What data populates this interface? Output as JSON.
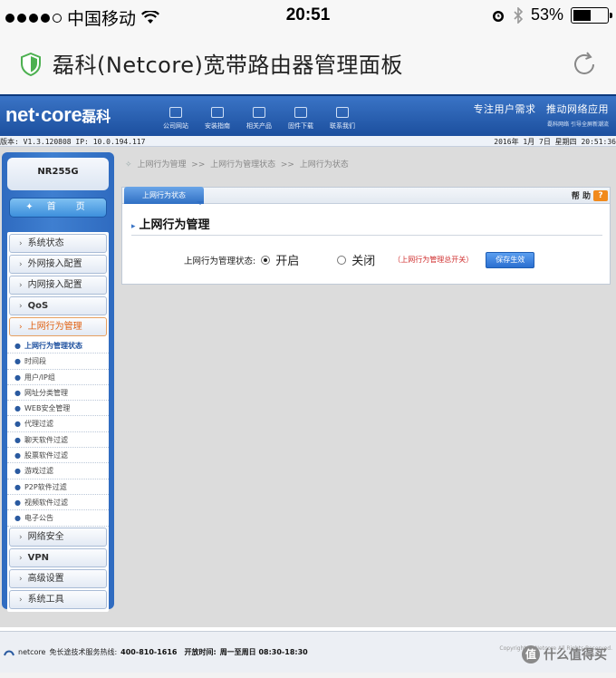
{
  "statusbar": {
    "carrier": "中国移动",
    "time": "20:51",
    "battery": "53%",
    "battery_level": 0.53
  },
  "browser": {
    "page_title": "磊科(Netcore)宽带路由器管理面板"
  },
  "header": {
    "logo": "net·core",
    "logo_cn": "磊科",
    "nav": [
      {
        "label": "公司网站",
        "icon": "website-icon"
      },
      {
        "label": "安装指南",
        "icon": "guide-icon"
      },
      {
        "label": "相关产品",
        "icon": "products-icon"
      },
      {
        "label": "固件下载",
        "icon": "download-icon"
      },
      {
        "label": "联系我们",
        "icon": "contact-icon"
      }
    ],
    "slogan": "专注用户需求　推动网络应用",
    "slogan_small": "磊科网络 引导全屏新潮流"
  },
  "infobar": {
    "version": "版本: V1.3.120808  IP: 10.0.194.117",
    "datetime": "2016年 1月 7日 星期四 20:51:36"
  },
  "sidebar": {
    "model": "NR255G",
    "home": "首　页",
    "menu_top": [
      "系统状态",
      "外网接入配置",
      "内网接入配置",
      "QoS"
    ],
    "active_menu": "上网行为管理",
    "submenu": [
      "上网行为管理状态",
      "时间段",
      "用户/IP组",
      "网址分类管理",
      "WEB安全管理",
      "代理过滤",
      "聊天软件过滤",
      "股票软件过滤",
      "游戏过滤",
      "P2P软件过滤",
      "视频软件过滤",
      "电子公告"
    ],
    "menu_bottom": [
      "网络安全",
      "VPN",
      "高级设置",
      "系统工具"
    ]
  },
  "breadcrumb": {
    "a": "上网行为管理",
    "sep1": ">>",
    "b": "上网行为管理状态",
    "sep2": ">>",
    "c": "上网行为状态"
  },
  "panel": {
    "tab": "上网行为状态",
    "help": "帮 助",
    "help_icon": "?",
    "section_title": "上网行为管理",
    "status_label": "上网行为管理状态:",
    "option_on": "开启",
    "option_off": "关闭",
    "selected": "开启",
    "note": "（上网行为管理总开关）",
    "save": "保存生效"
  },
  "footer": {
    "hotline_brand": "netcore",
    "hotline_label": "免长途技术服务热线:",
    "hotline_number": "400-810-1616",
    "hours_label": "开放时间:",
    "hours": "周一至周日 08:30-18:30",
    "copyright": "Copyright © Netcore All Rights Reserved."
  },
  "watermark": {
    "text": "什么值得买",
    "icon": "值"
  },
  "colors": {
    "header_blue": "#1c4f9e",
    "active_orange": "#e06010",
    "note_red": "#d03030"
  }
}
